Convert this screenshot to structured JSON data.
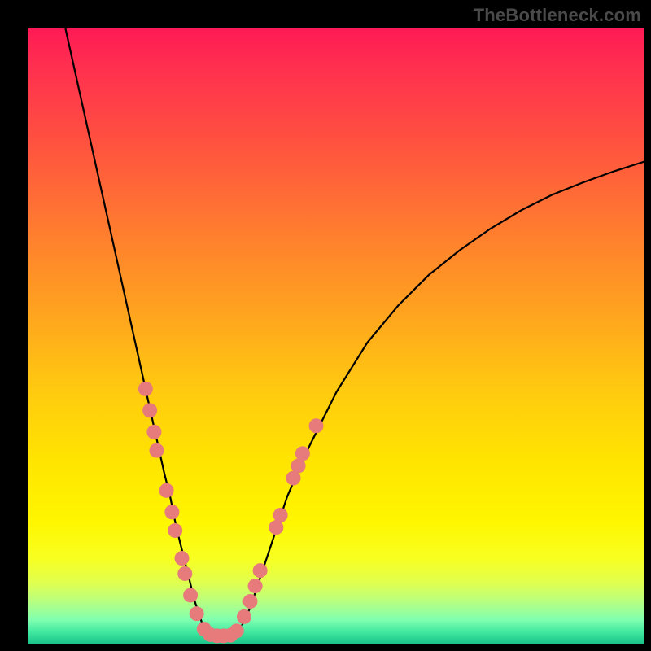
{
  "watermark": "TheBottleneck.com",
  "colors": {
    "background": "#000000",
    "dot": "#e77a7a",
    "curve": "#000000"
  },
  "chart_data": {
    "type": "line",
    "title": "",
    "xlabel": "",
    "ylabel": "",
    "xlim": [
      0,
      100
    ],
    "ylim": [
      0,
      100
    ],
    "series": [
      {
        "name": "left-branch",
        "x": [
          6,
          8,
          10,
          12,
          14,
          16,
          18,
          20,
          22,
          23,
          24,
          25,
          26,
          27,
          28,
          28.8
        ],
        "y": [
          100,
          91,
          82,
          73,
          64,
          55,
          46,
          37,
          28,
          24,
          19,
          15,
          11,
          7,
          4,
          1.5
        ]
      },
      {
        "name": "valley-floor",
        "x": [
          28.8,
          30.5,
          32.2,
          34.0
        ],
        "y": [
          1.5,
          1.3,
          1.3,
          1.7
        ]
      },
      {
        "name": "right-branch",
        "x": [
          34.0,
          36,
          38,
          40,
          42,
          45,
          50,
          55,
          60,
          65,
          70,
          75,
          80,
          85,
          90,
          95,
          100
        ],
        "y": [
          1.7,
          6,
          12,
          18,
          24,
          31,
          41,
          49,
          55,
          60,
          64,
          67.5,
          70.5,
          73,
          75,
          76.8,
          78.4
        ]
      }
    ],
    "dots": [
      {
        "x": 19.0,
        "y": 41.5
      },
      {
        "x": 19.7,
        "y": 38.0
      },
      {
        "x": 20.4,
        "y": 34.5
      },
      {
        "x": 20.8,
        "y": 31.5
      },
      {
        "x": 22.4,
        "y": 25.0
      },
      {
        "x": 23.3,
        "y": 21.5
      },
      {
        "x": 23.8,
        "y": 18.5
      },
      {
        "x": 24.9,
        "y": 14.0
      },
      {
        "x": 25.4,
        "y": 11.5
      },
      {
        "x": 26.3,
        "y": 8.0
      },
      {
        "x": 27.3,
        "y": 5.0
      },
      {
        "x": 28.5,
        "y": 2.5
      },
      {
        "x": 29.5,
        "y": 1.6
      },
      {
        "x": 30.6,
        "y": 1.4
      },
      {
        "x": 31.7,
        "y": 1.4
      },
      {
        "x": 32.8,
        "y": 1.5
      },
      {
        "x": 33.8,
        "y": 2.2
      },
      {
        "x": 35.0,
        "y": 4.5
      },
      {
        "x": 36.0,
        "y": 7.0
      },
      {
        "x": 36.8,
        "y": 9.5
      },
      {
        "x": 37.6,
        "y": 12.0
      },
      {
        "x": 40.2,
        "y": 19.0
      },
      {
        "x": 40.9,
        "y": 21.0
      },
      {
        "x": 43.0,
        "y": 27.0
      },
      {
        "x": 43.8,
        "y": 29.0
      },
      {
        "x": 44.5,
        "y": 31.0
      },
      {
        "x": 46.7,
        "y": 35.5
      }
    ]
  }
}
